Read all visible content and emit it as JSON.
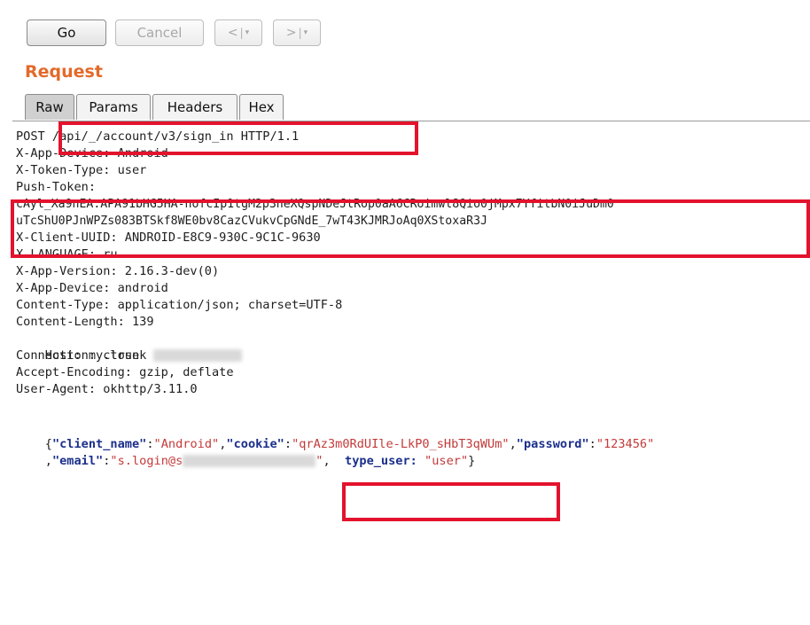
{
  "toolbar": {
    "go_label": "Go",
    "cancel_label": "Cancel",
    "back_arrow": "<",
    "fwd_arrow": ">",
    "separator": "|",
    "dropdown": "▾"
  },
  "request": {
    "title": "Request",
    "tabs": [
      "Raw",
      "Params",
      "Headers",
      "Hex"
    ],
    "active_tab": "Raw"
  },
  "raw": {
    "lines": [
      "POST /api/_/account/v3/sign_in HTTP/1.1",
      "X-App-Device: Android",
      "X-Token-Type: user",
      "Push-Token:",
      "cAyl_Xa9nEA:APA91bHG5HA-nofcIp1tgM2p3neXQspNDeJtRop0aA6CRoimwl8Qio0jMpx7YfitbN0iJuDm0",
      "uTcShU0PJnWPZs083BTSkf8WE0bv8CazCVukvCpGNdE_7wT43KJMRJoAq0XStoxaR3J",
      "X-Client-UUID: ANDROID-E8C9-930C-9C1C-9630",
      "X-LANGUAGE: ru",
      "X-App-Version: 2.16.3-dev(0)",
      "X-App-Device: android",
      "Content-Type: application/json; charset=UTF-8",
      "Content-Length: 139",
      "Host: my.trunk",
      "Connection: close",
      "Accept-Encoding: gzip, deflate",
      "User-Agent: okhttp/3.11.0"
    ],
    "body": {
      "open": "{",
      "k_client_name": "\"client_name\"",
      "v_client_name": "\"Android\"",
      "k_cookie": "\"cookie\"",
      "v_cookie": "\"qrAz3m0RdUIle-LkP0_sHbT3qWUm\"",
      "k_password": "\"password\"",
      "v_password": "\"123456\"",
      "comma_lead": ",",
      "k_email": "\"email\"",
      "v_email_start": "\"s.login@s",
      "v_email_end": "\"",
      "k_type_user": "type_user:",
      "v_type_user": "\"user\"",
      "close": "}"
    }
  },
  "colors": {
    "section_title": "#e36a2b",
    "highlight_box": "#e3132d",
    "json_key": "#1b2f8c",
    "json_value": "#c43a3a"
  }
}
